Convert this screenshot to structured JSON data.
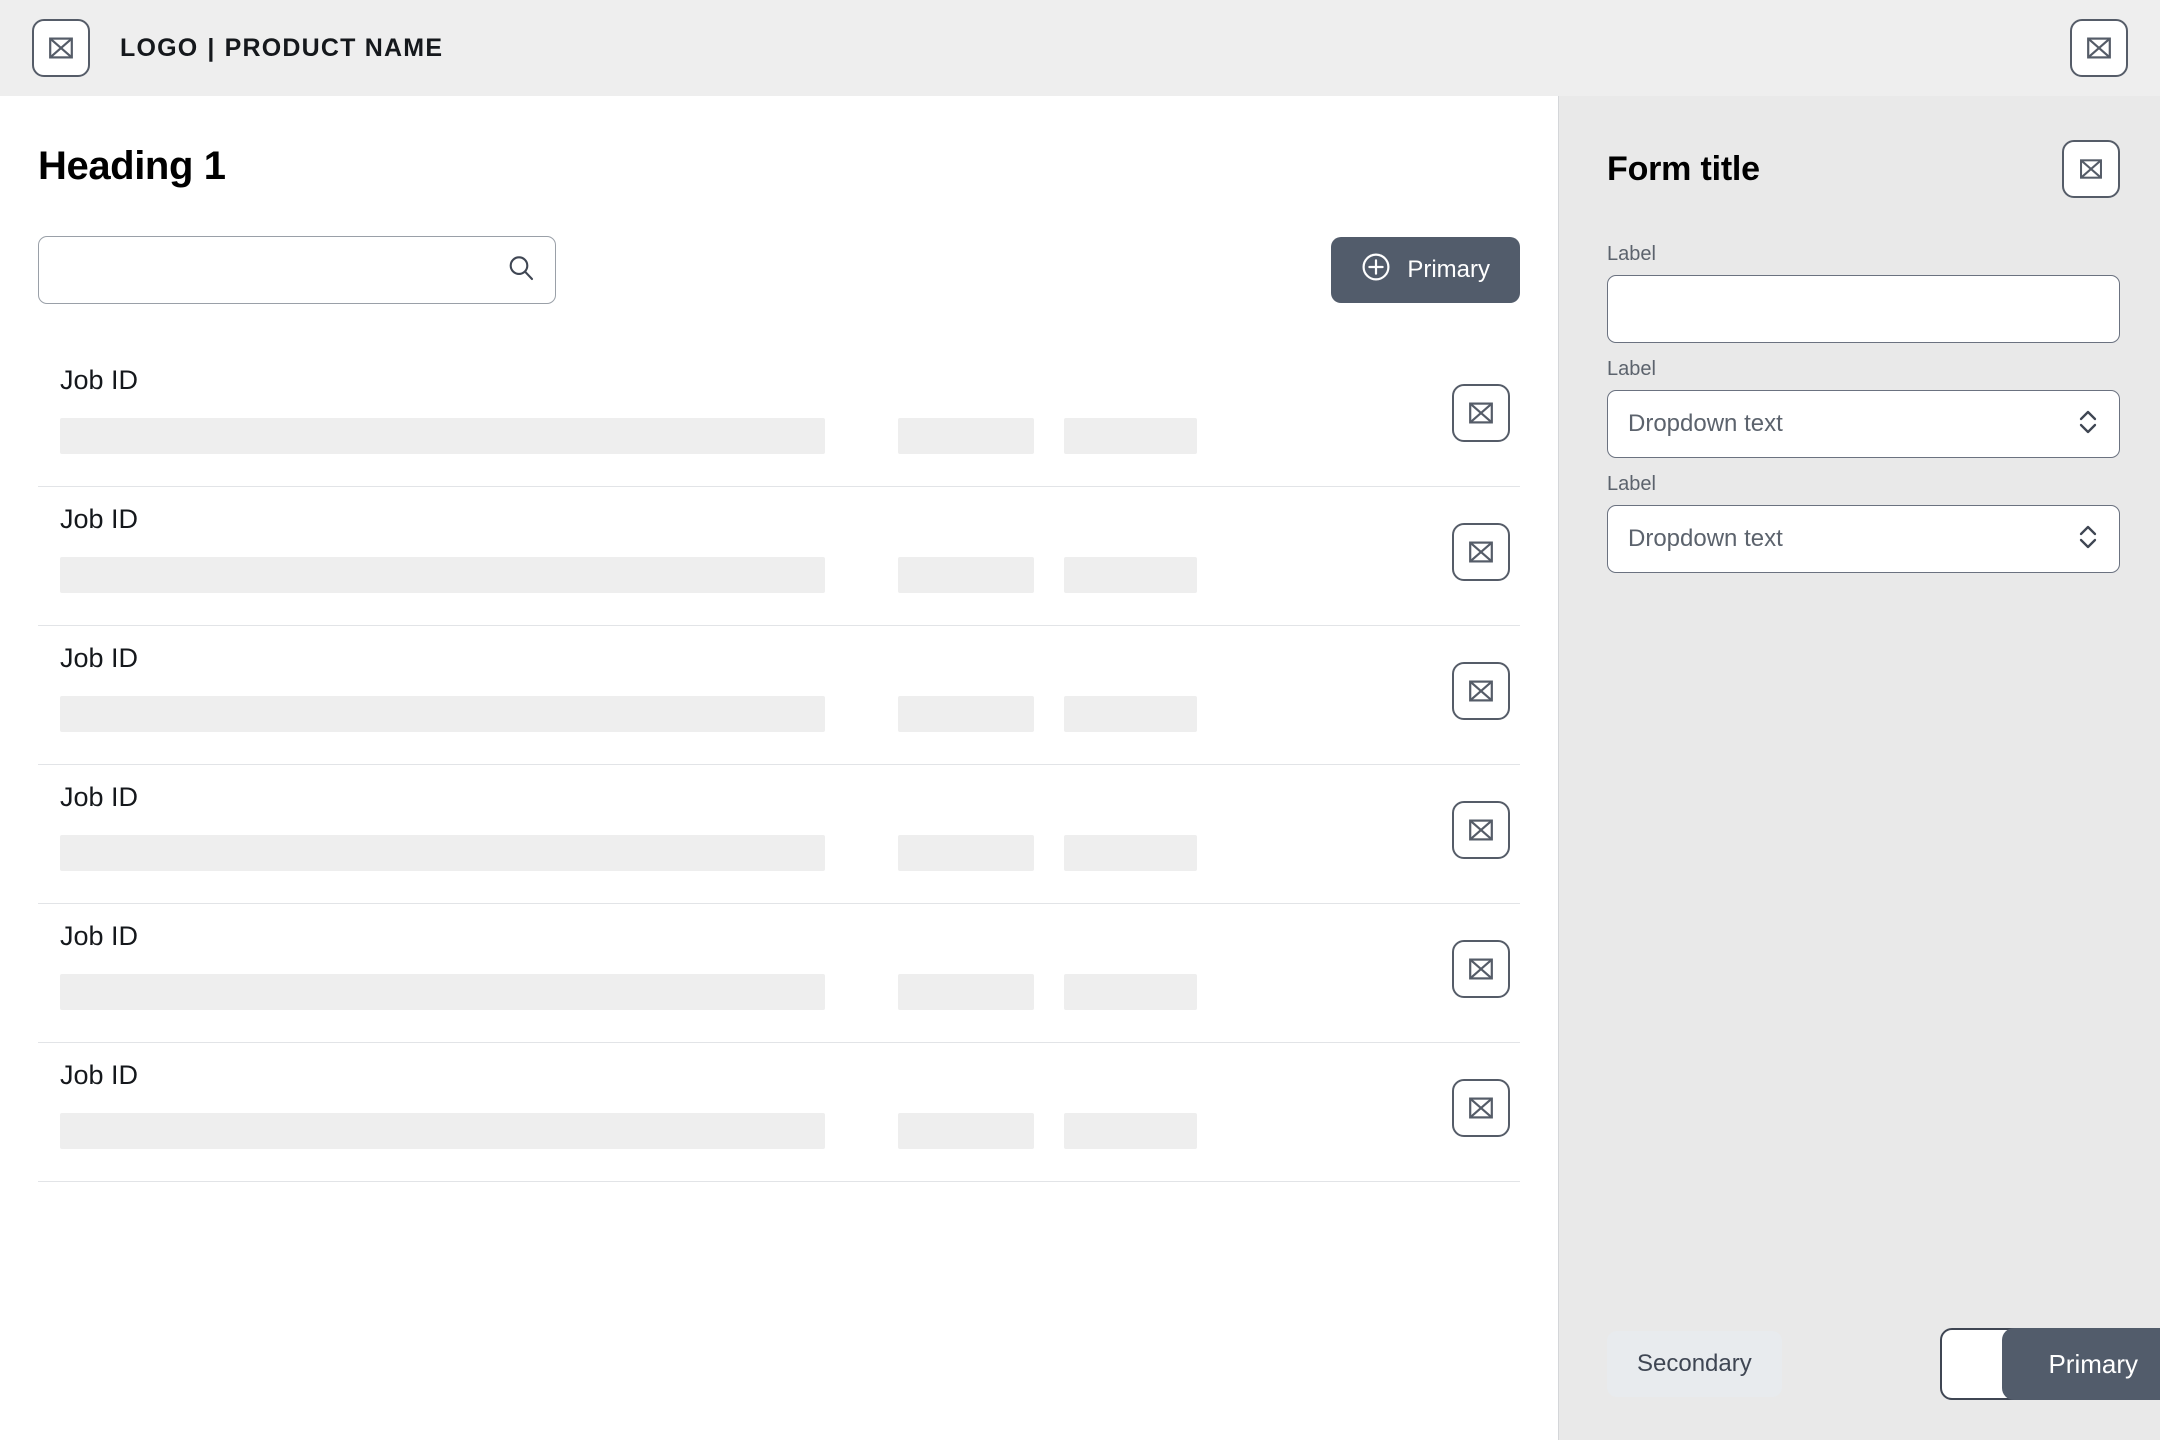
{
  "header": {
    "logo_icon": "image-placeholder-icon",
    "brand_logo": "LOGO",
    "brand_separator": "|",
    "brand_product": "PRODUCT NAME",
    "action_icon": "image-placeholder-icon"
  },
  "main": {
    "heading": "Heading 1",
    "search": {
      "value": "",
      "placeholder": "",
      "icon": "search-icon"
    },
    "primary_button": {
      "label": "Primary",
      "icon": "plus-circle-icon"
    },
    "rows": [
      {
        "job_id": "Job ID",
        "action_icon": "image-placeholder-icon"
      },
      {
        "job_id": "Job ID",
        "action_icon": "image-placeholder-icon"
      },
      {
        "job_id": "Job ID",
        "action_icon": "image-placeholder-icon"
      },
      {
        "job_id": "Job ID",
        "action_icon": "image-placeholder-icon"
      },
      {
        "job_id": "Job ID",
        "action_icon": "image-placeholder-icon"
      },
      {
        "job_id": "Job ID",
        "action_icon": "image-placeholder-icon"
      }
    ]
  },
  "panel": {
    "title": "Form title",
    "close_icon": "image-placeholder-icon",
    "fields": [
      {
        "label": "Label",
        "type": "text",
        "value": "",
        "placeholder": ""
      },
      {
        "label": "Label",
        "type": "select",
        "value": "Dropdown text",
        "icon": "chevron-up-down-icon"
      },
      {
        "label": "Label",
        "type": "select",
        "value": "Dropdown text",
        "icon": "chevron-up-down-icon"
      }
    ],
    "footer": {
      "secondary_label": "Secondary",
      "primary_label": "Primary"
    }
  },
  "colors": {
    "header_bg": "#eeeeee",
    "panel_bg": "#e9e9e9",
    "primary_btn": "#525c6b",
    "secondary_btn": "#e8ebee",
    "skeleton": "#eeeeee",
    "icon_stroke": "#555c68",
    "divider": "#e2e4e7"
  }
}
